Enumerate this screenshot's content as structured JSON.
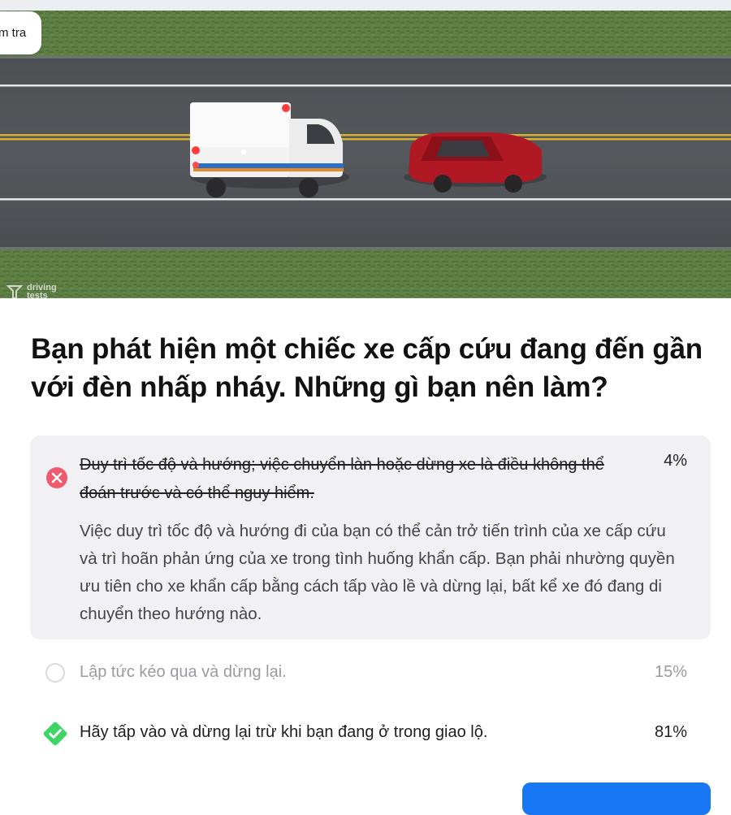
{
  "top_pill": {
    "label": "m tra"
  },
  "watermark": {
    "line1": "driving",
    "line2": "tests",
    "icon": "driving-tests-logo"
  },
  "question": "Bạn phát hiện một chiếc xe cấp cứu đang đến gần với đèn nhấp nháy. Những gì bạn nên làm?",
  "options": [
    {
      "text": "Duy trì tốc độ và hướng; việc chuyển làn hoặc dừng xe là điều không thể đoán trước và có thể nguy hiểm.",
      "percent": "4%",
      "state": "wrong-selected",
      "icon": "x-circle-icon",
      "explanation": "Việc duy trì tốc độ và hướng đi của bạn có thể cản trở tiến trình của xe cấp cứu và trì hoãn phản ứng của xe trong tình huống khẩn cấp. Bạn phải nhường quyền ưu tiên cho xe khẩn cấp bằng cách tấp vào lề và dừng lại, bất kể xe đó đang di chuyển theo hướng nào."
    },
    {
      "text": "Lập tức kéo qua và dừng lại.",
      "percent": "15%",
      "state": "unselected",
      "icon": "radio-empty-icon"
    },
    {
      "text": "Hãy tấp vào và dừng lại trừ khi bạn đang ở trong giao lộ.",
      "percent": "81%",
      "state": "correct",
      "icon": "check-diamond-icon"
    }
  ],
  "colors": {
    "wrong": "#ef5b6e",
    "correct": "#3fd466",
    "button": "#1877f2",
    "card_bg": "#f1f1f5"
  }
}
